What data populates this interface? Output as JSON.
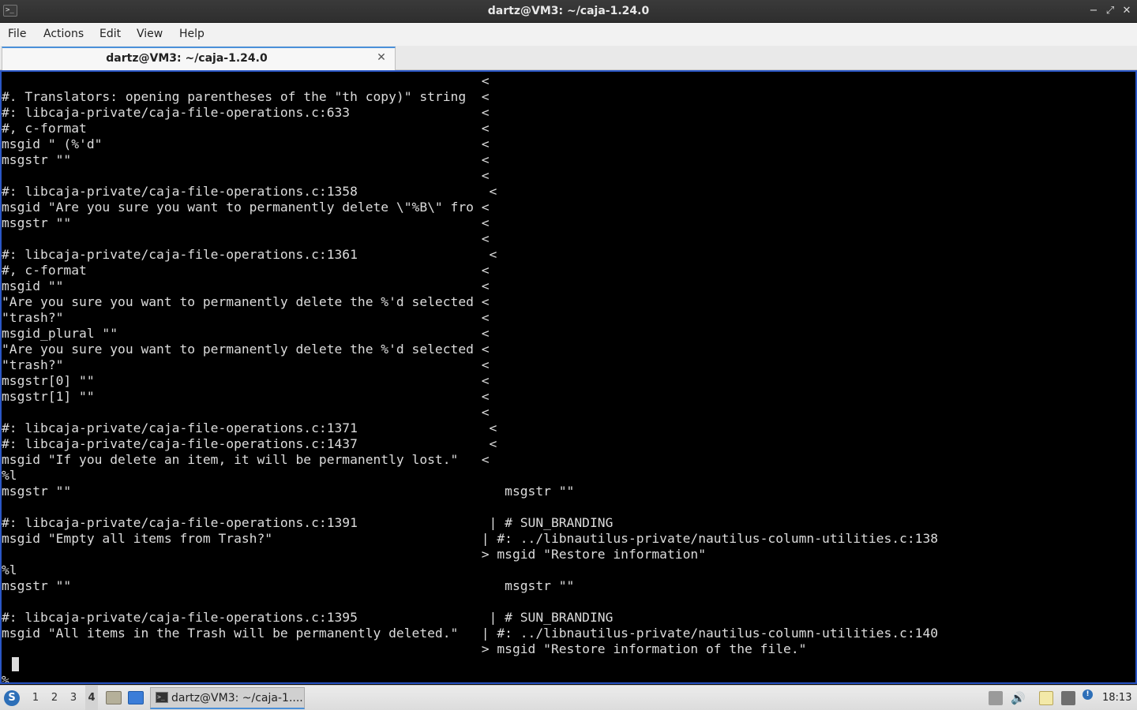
{
  "window": {
    "title": "dartz@VM3: ~/caja-1.24.0",
    "app_icon": ">_",
    "buttons": {
      "minimize": "−",
      "maximize": "⤢",
      "close": "✕"
    }
  },
  "menu": [
    "File",
    "Actions",
    "Edit",
    "View",
    "Help"
  ],
  "tab": {
    "label": "dartz@VM3: ~/caja-1.24.0",
    "close": "✕"
  },
  "terminal": {
    "lines": [
      "                                                              <",
      "#. Translators: opening parentheses of the \"th copy)\" string  <",
      "#: libcaja-private/caja-file-operations.c:633                 <",
      "#, c-format                                                   <",
      "msgid \" (%'d\"                                                 <",
      "msgstr \"\"                                                     <",
      "                                                              <",
      "#: libcaja-private/caja-file-operations.c:1358                 <",
      "msgid \"Are you sure you want to permanently delete \\\"%B\\\" fro <",
      "msgstr \"\"                                                     <",
      "                                                              <",
      "#: libcaja-private/caja-file-operations.c:1361                 <",
      "#, c-format                                                   <",
      "msgid \"\"                                                      <",
      "\"Are you sure you want to permanently delete the %'d selected <",
      "\"trash?\"                                                      <",
      "msgid_plural \"\"                                               <",
      "\"Are you sure you want to permanently delete the %'d selected <",
      "\"trash?\"                                                      <",
      "msgstr[0] \"\"                                                  <",
      "msgstr[1] \"\"                                                  <",
      "                                                              <",
      "#: libcaja-private/caja-file-operations.c:1371                 <",
      "#: libcaja-private/caja-file-operations.c:1437                 <",
      "msgid \"If you delete an item, it will be permanently lost.\"   <",
      "%l",
      "msgstr \"\"                                                        msgstr \"\"",
      "",
      "#: libcaja-private/caja-file-operations.c:1391                 | # SUN_BRANDING",
      "msgid \"Empty all items from Trash?\"                           | #: ../libnautilus-private/nautilus-column-utilities.c:138",
      "                                                              > msgid \"Restore information\"",
      "%l",
      "msgstr \"\"                                                        msgstr \"\"",
      "",
      "#: libcaja-private/caja-file-operations.c:1395                 | # SUN_BRANDING",
      "msgid \"All items in the Trash will be permanently deleted.\"   | #: ../libnautilus-private/nautilus-column-utilities.c:140",
      "                                                              > msgid \"Restore information of the file.\"",
      "",
      "%"
    ]
  },
  "taskbar": {
    "start_icon": "S",
    "desktops": [
      "1",
      "2",
      "3",
      "4"
    ],
    "active_desktop": "4",
    "task_icon": ">_",
    "task_label": "dartz@VM3: ~/caja-1....",
    "volume_icon": "🔊",
    "info_icon": "!",
    "clock": "18:13"
  }
}
